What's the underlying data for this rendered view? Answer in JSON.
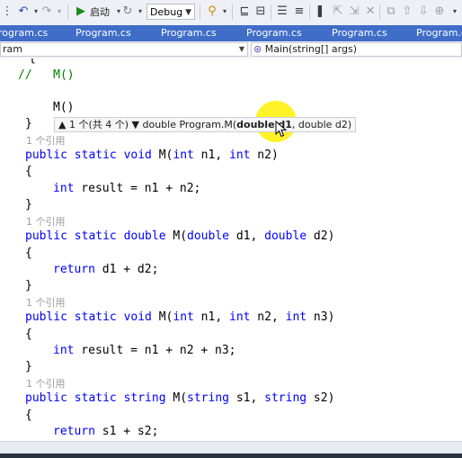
{
  "toolbar": {
    "start_label": "启动",
    "config_value": "Debug"
  },
  "tabs": [
    {
      "label": "rogram.cs"
    },
    {
      "label": "Program.cs"
    },
    {
      "label": "Program.cs"
    },
    {
      "label": "Program.cs"
    },
    {
      "label": "Program.cs"
    },
    {
      "label": "Program.cs"
    }
  ],
  "navbar": {
    "left": "ram",
    "right": "Main(string[] args)"
  },
  "code": {
    "l_brace_top": "{",
    "l_comment": "//   M()",
    "l_call": "M()",
    "l_close1": "}",
    "lens1": "1 个引用",
    "m1_sig_kw": "public static void",
    "m1_sig_rest": " M(",
    "m1_p1_kw": "int",
    "m1_p1": " n1, ",
    "m1_p2_kw": "int",
    "m1_p2": " n2)",
    "m1_open": "{",
    "m1_body_kw": "int",
    "m1_body": " result = n1 + n2;",
    "m1_close": "}",
    "lens2": "1 个引用",
    "m2_sig_kw": "public static double",
    "m2_sig_rest": " M(",
    "m2_p1_kw": "double",
    "m2_p1": " d1, ",
    "m2_p2_kw": "double",
    "m2_p2": " d2)",
    "m2_open": "{",
    "m2_body_kw": "return",
    "m2_body": " d1 + d2;",
    "m2_close": "}",
    "lens3": "1 个引用",
    "m3_sig_kw": "public static void",
    "m3_sig_rest": " M(",
    "m3_p1_kw": "int",
    "m3_p1": " n1, ",
    "m3_p2_kw": "int",
    "m3_p2": " n2, ",
    "m3_p3_kw": "int",
    "m3_p3": " n3)",
    "m3_open": "{",
    "m3_body_kw": "int",
    "m3_body": " result = n1 + n2 + n3;",
    "m3_close": "}",
    "lens4": "1 个引用",
    "m4_sig_kw": "public static string",
    "m4_sig_rest": " M(",
    "m4_p1_kw": "string",
    "m4_p1": " s1, ",
    "m4_p2_kw": "string",
    "m4_p2": " s2)",
    "m4_open": "{",
    "m4_body_kw": "return",
    "m4_body": " s1 + s2;"
  },
  "signature_help": {
    "counter": "▲ 1 个(共 4 个) ▼",
    "prefix": "double Program.M(",
    "current_param": "double d1",
    "rest": ", double d2)"
  },
  "colors": {
    "keyword": "#0000ff",
    "comment": "#008000",
    "tab_bar": "#3f6dc8",
    "lens": "#9a9a9a"
  }
}
